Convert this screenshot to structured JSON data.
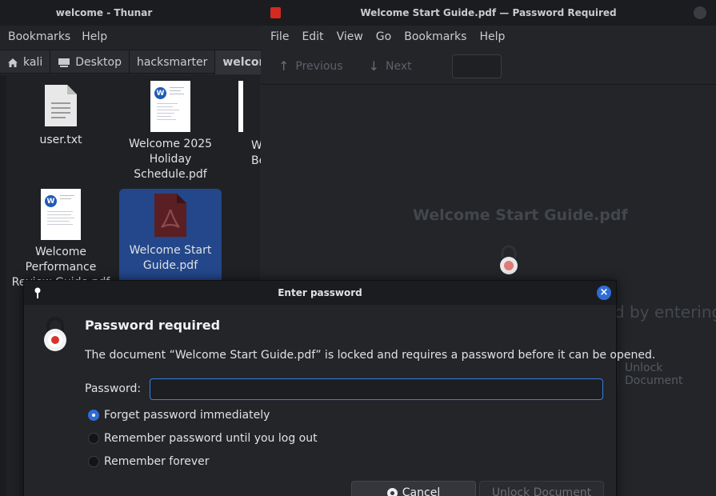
{
  "thunar": {
    "title": "welcome - Thunar",
    "menu": [
      "Bookmarks",
      "Help"
    ],
    "path": [
      "kali",
      "Desktop",
      "hacksmarter",
      "welcome"
    ],
    "files": [
      {
        "name": "user.txt",
        "kind": "text-file-icon"
      },
      {
        "name": "Welcome 2025 Holiday Schedule.pdf",
        "kind": "pdf-thumbnail"
      },
      {
        "name": "W Be",
        "kind": "pdf-thumbnail"
      },
      {
        "name": "Welcome Performance Review Guide.pdf",
        "kind": "pdf-thumbnail"
      },
      {
        "name": "Welcome Start Guide.pdf",
        "kind": "pdf-file-icon"
      }
    ]
  },
  "viewer": {
    "title": "Welcome Start Guide.pdf — Password Required",
    "menu": [
      "File",
      "Edit",
      "View",
      "Go",
      "Bookmarks",
      "Help"
    ],
    "toolbar": {
      "previous": "Previous",
      "next": "Next"
    },
    "doc_title": "Welcome Start Guide.pdf",
    "hint": "d by entering",
    "unlock": "Unlock Document"
  },
  "dialog": {
    "title": "Enter password",
    "heading": "Password required",
    "message": "The document “Welcome Start Guide.pdf” is locked and requires a password before it can be opened.",
    "password_label": "Password:",
    "password_value": "",
    "options": [
      "Forget password immediately",
      "Remember password until you log out",
      "Remember forever"
    ],
    "selected_option": 0,
    "cancel": "Cancel",
    "unlock": "Unlock Document"
  },
  "colors": {
    "accent": "#2f6cd6",
    "selection": "#23478a",
    "lock_red": "#d8332a"
  }
}
